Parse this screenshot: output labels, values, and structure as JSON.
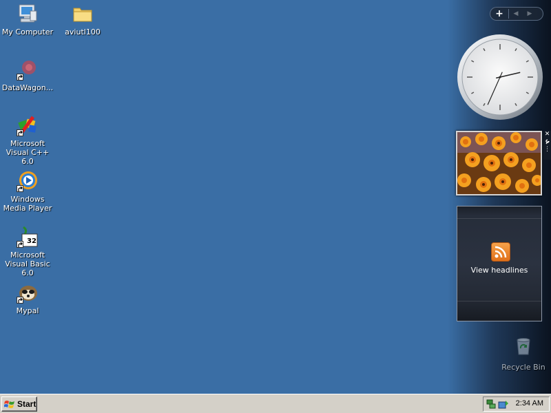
{
  "desktop": {
    "background_color": "#3a6ea5",
    "icons": [
      {
        "label": "My Computer",
        "icon": "computer-icon"
      },
      {
        "label": "aviutl100",
        "icon": "folder-icon"
      },
      {
        "label": "DataWagon...",
        "icon": "datawagon-icon",
        "shortcut": true
      },
      {
        "label": "Microsoft Visual C++ 6.0",
        "icon": "visual-cpp-icon",
        "shortcut": true
      },
      {
        "label": "Windows Media Player",
        "icon": "media-player-icon",
        "shortcut": true
      },
      {
        "label": "Microsoft Visual Basic 6.0",
        "icon": "visual-basic-icon",
        "shortcut": true
      },
      {
        "label": "Mypal",
        "icon": "mypal-icon",
        "shortcut": true
      }
    ],
    "recycle_bin": {
      "label": "Recycle Bin",
      "icon": "recycle-bin-icon"
    }
  },
  "sidebar": {
    "controls": {
      "add": "+",
      "prev": "◀",
      "next": "▶"
    },
    "clock": {
      "hour": 2,
      "minute": 34,
      "icon": "analog-clock"
    },
    "slideshow": {
      "icon": "flower-photo",
      "tools": {
        "close": "✕",
        "options": "🔧",
        "drag": "⋮"
      }
    },
    "feed": {
      "label": "View headlines",
      "icon": "rss-icon"
    }
  },
  "taskbar": {
    "start_label": "Start",
    "tray_icons": [
      "network-icon",
      "safely-remove-icon"
    ],
    "time": "2:34 AM"
  }
}
